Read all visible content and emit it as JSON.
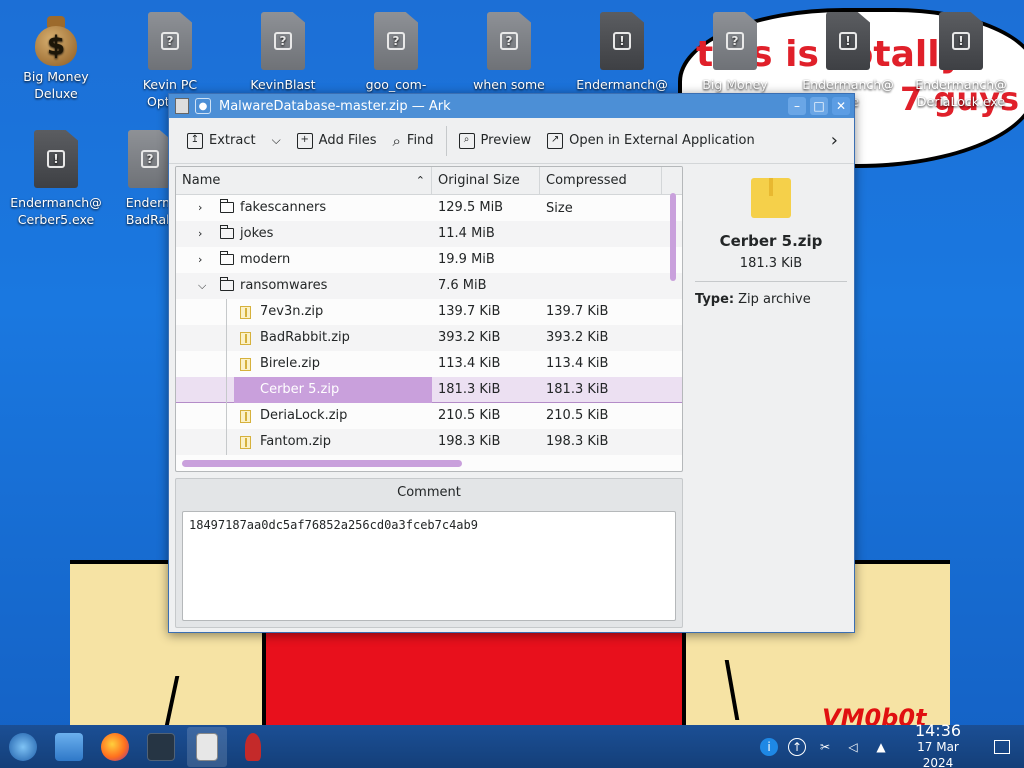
{
  "wallpaper": {
    "speech_line1": "this is totally",
    "speech_line2": "7 guys",
    "signature": "VM0b0t"
  },
  "desktop_icons": [
    {
      "label": "Big Money Deluxe",
      "icon": "money-bag-icon"
    },
    {
      "label": "Kevin PC Optimi:",
      "icon": "unknown-file-icon"
    },
    {
      "label": "KevinBlast",
      "icon": "unknown-file-icon"
    },
    {
      "label": "goo_com-",
      "icon": "unknown-file-icon"
    },
    {
      "label": "when some",
      "icon": "unknown-file-icon"
    },
    {
      "label": "Endermanch@",
      "icon": "executable-icon"
    },
    {
      "label": "Big Money",
      "icon": "unknown-file-icon"
    },
    {
      "label": "Endermanch@ exe",
      "icon": "executable-icon"
    },
    {
      "label": "Endermanch@ DeriaLock.exe",
      "icon": "executable-icon"
    },
    {
      "label": "Endermanch@ Cerber5.exe",
      "icon": "executable-icon"
    },
    {
      "label": "Enderm BadRab",
      "icon": "unknown-file-icon"
    }
  ],
  "window": {
    "title": "MalwareDatabase-master.zip — Ark",
    "toolbar": {
      "extract": "Extract",
      "add_files": "Add Files",
      "find": "Find",
      "preview": "Preview",
      "open_external": "Open in External Application"
    },
    "columns": {
      "name": "Name",
      "original_size": "Original Size",
      "compressed_size": "Compressed Size"
    },
    "rows": [
      {
        "name": "fakescanners",
        "orig": "129.5 MiB",
        "comp": "",
        "type": "folder",
        "expanded": false
      },
      {
        "name": "jokes",
        "orig": "11.4 MiB",
        "comp": "",
        "type": "folder",
        "expanded": false
      },
      {
        "name": "modern",
        "orig": "19.9 MiB",
        "comp": "",
        "type": "folder",
        "expanded": false
      },
      {
        "name": "ransomwares",
        "orig": "7.6 MiB",
        "comp": "",
        "type": "folder",
        "expanded": true
      },
      {
        "name": "7ev3n.zip",
        "orig": "139.7 KiB",
        "comp": "139.7 KiB",
        "type": "zip"
      },
      {
        "name": "BadRabbit.zip",
        "orig": "393.2 KiB",
        "comp": "393.2 KiB",
        "type": "zip"
      },
      {
        "name": "Birele.zip",
        "orig": "113.4 KiB",
        "comp": "113.4 KiB",
        "type": "zip"
      },
      {
        "name": "Cerber 5.zip",
        "orig": "181.3 KiB",
        "comp": "181.3 KiB",
        "type": "zip",
        "selected": true
      },
      {
        "name": "DeriaLock.zip",
        "orig": "210.5 KiB",
        "comp": "210.5 KiB",
        "type": "zip"
      },
      {
        "name": "Fantom.zip",
        "orig": "198.3 KiB",
        "comp": "198.3 KiB",
        "type": "zip"
      }
    ],
    "details": {
      "name": "Cerber 5.zip",
      "size": "181.3 KiB",
      "type_label": "Type:",
      "type_value": "Zip archive"
    },
    "comment": {
      "title": "Comment",
      "text": "18497187aa0dc5af76852a256cd0a3fceb7c4ab9"
    }
  },
  "taskbar": {
    "clock_time": "14:36",
    "clock_date": "17 Mar 2024"
  }
}
